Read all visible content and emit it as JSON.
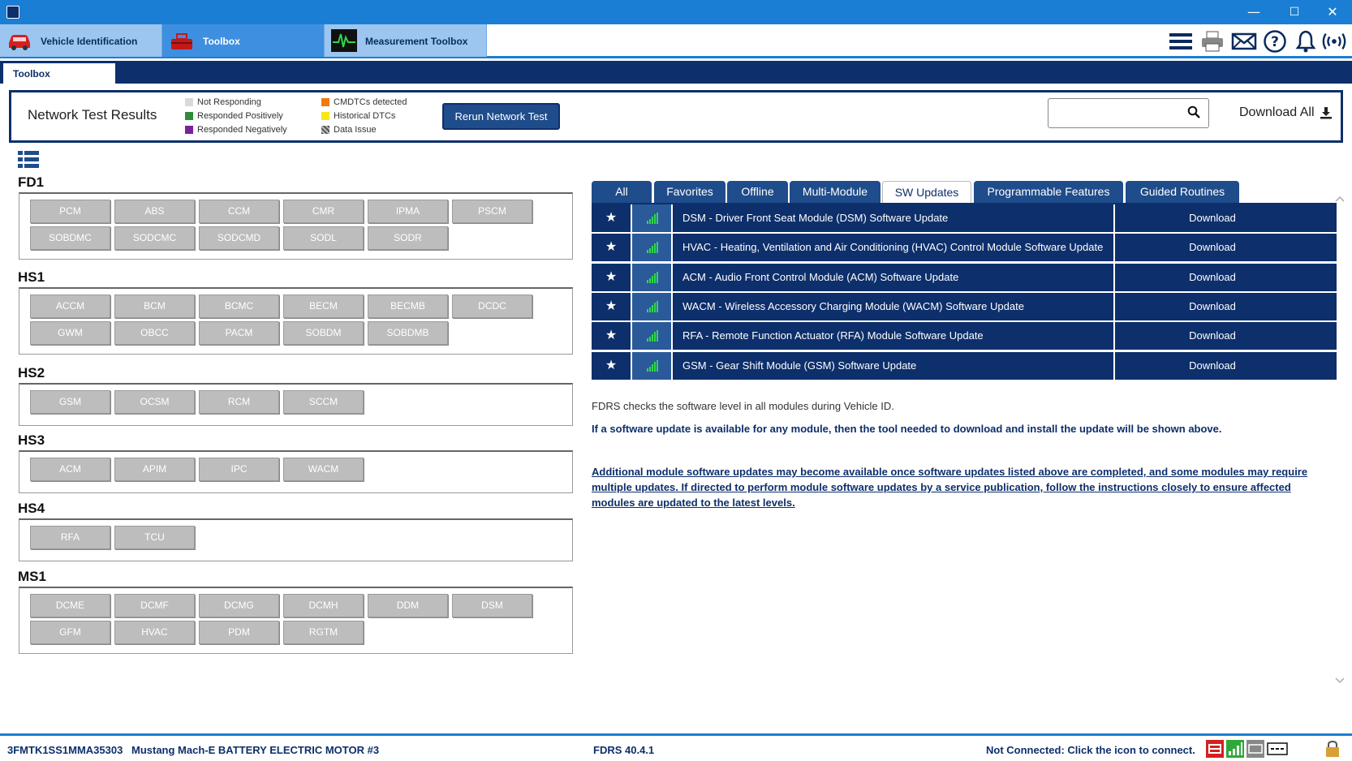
{
  "window": {
    "title_icon": "fdrs-app-icon",
    "minimize": "—",
    "maximize": "☐",
    "close": "✕"
  },
  "top_tabs": [
    {
      "label": "Vehicle Identification",
      "icon": "car-icon"
    },
    {
      "label": "Toolbox",
      "icon": "toolbox-icon"
    },
    {
      "label": "Measurement Toolbox",
      "icon": "oscilloscope-icon"
    }
  ],
  "header_icons": [
    "menu-icon",
    "printer-icon",
    "mail-icon",
    "help-icon",
    "bell-icon",
    "wireless-icon"
  ],
  "sub_tab": "Toolbox",
  "network": {
    "title": "Network Test Results",
    "legend": [
      {
        "label": "Not Responding",
        "color": "#d9d9d9"
      },
      {
        "label": "Responded Positively",
        "color": "#2e8b3a"
      },
      {
        "label": "Responded Negatively",
        "color": "#7a1fa2"
      },
      {
        "label": "CMDTCs detected",
        "color": "#f07a10"
      },
      {
        "label": "Historical DTCs",
        "color": "#f4e81a"
      },
      {
        "label": "Data Issue",
        "color": "#777777"
      }
    ],
    "rerun_label": "Rerun Network Test",
    "search_value": "",
    "download_all": "Download All"
  },
  "groups": [
    {
      "name": "FD1",
      "modules": [
        "PCM",
        "ABS",
        "CCM",
        "CMR",
        "IPMA",
        "PSCM",
        "SOBDMC",
        "SODCMC",
        "SODCMD",
        "SODL",
        "SODR"
      ]
    },
    {
      "name": "HS1",
      "modules": [
        "ACCM",
        "BCM",
        "BCMC",
        "BECM",
        "BECMB",
        "DCDC",
        "GWM",
        "OBCC",
        "PACM",
        "SOBDM",
        "SOBDMB"
      ]
    },
    {
      "name": "HS2",
      "modules": [
        "GSM",
        "OCSM",
        "RCM",
        "SCCM"
      ]
    },
    {
      "name": "HS3",
      "modules": [
        "ACM",
        "APIM",
        "IPC",
        "WACM"
      ]
    },
    {
      "name": "HS4",
      "modules": [
        "RFA",
        "TCU"
      ]
    },
    {
      "name": "MS1",
      "modules": [
        "DCME",
        "DCMF",
        "DCMG",
        "DCMH",
        "DDM",
        "DSM",
        "GFM",
        "HVAC",
        "PDM",
        "RGTM"
      ]
    }
  ],
  "right_tabs": [
    "All",
    "Favorites",
    "Offline",
    "Multi-Module",
    "SW Updates",
    "Programmable Features",
    "Guided Routines"
  ],
  "active_right_tab": "SW Updates",
  "updates": [
    {
      "text": "DSM - Driver Front Seat Module (DSM) Software Update",
      "action": "Download"
    },
    {
      "text": "HVAC - Heating, Ventilation and Air Conditioning (HVAC) Control Module Software Update",
      "action": "Download"
    },
    {
      "text": "ACM - Audio Front Control Module (ACM) Software Update",
      "action": "Download"
    },
    {
      "text": "WACM - Wireless Accessory Charging Module (WACM) Software Update",
      "action": "Download"
    },
    {
      "text": "RFA - Remote Function Actuator (RFA) Module Software Update",
      "action": "Download"
    },
    {
      "text": "GSM - Gear Shift Module (GSM) Software Update",
      "action": "Download"
    }
  ],
  "info": {
    "line1": "FDRS checks the software level in all modules during Vehicle ID.",
    "line2": "If a software update is available for any module, then the tool needed to download and install the update will be shown above.",
    "line3": "Additional module software updates may become available once software updates listed above are completed, and some modules may require multiple updates. If directed to perform module software updates by a service publication, follow the instructions closely to ensure affected modules are updated to the latest levels."
  },
  "status": {
    "vin": "3FMTK1SS1MMA35303",
    "vehicle": "Mustang Mach-E BATTERY ELECTRIC MOTOR #3",
    "version": "FDRS 40.4.1",
    "connection": "Not Connected: Click the icon to connect."
  }
}
